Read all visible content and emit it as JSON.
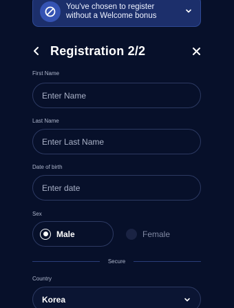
{
  "banner": {
    "text": "You've chosen to register\nwithout a Welcome bonus",
    "icon": "no-bonus-icon"
  },
  "header": {
    "title": "Registration 2/2",
    "back_icon": "chevron-left-icon",
    "close_icon": "close-icon"
  },
  "form": {
    "first_name": {
      "label": "First Name",
      "placeholder": "Enter Name",
      "value": ""
    },
    "last_name": {
      "label": "Last Name",
      "placeholder": "Enter Last Name",
      "value": ""
    },
    "dob": {
      "label": "Date of birth",
      "placeholder": "Enter date",
      "value": ""
    },
    "sex": {
      "label": "Sex",
      "options": [
        {
          "label": "Male",
          "selected": true
        },
        {
          "label": "Female",
          "selected": false
        }
      ]
    },
    "divider": "Secure",
    "country": {
      "label": "Country",
      "value": "Korea"
    }
  },
  "colors": {
    "background": "#07102a",
    "banner_bg": "#1c2f6b",
    "field_border": "#2d3a63",
    "text": "#ffffff",
    "muted": "#aeb6cc"
  }
}
